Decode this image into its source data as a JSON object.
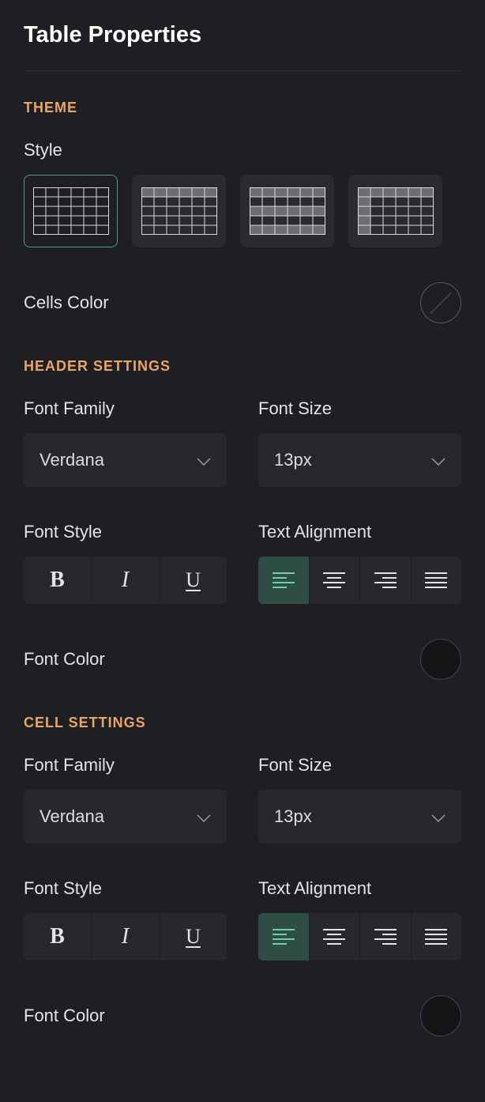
{
  "title": "Table Properties",
  "theme": {
    "heading": "THEME",
    "style_label": "Style",
    "cells_color_label": "Cells Color"
  },
  "header": {
    "heading": "HEADER SETTINGS",
    "font_family_label": "Font Family",
    "font_family_value": "Verdana",
    "font_size_label": "Font Size",
    "font_size_value": "13px",
    "font_style_label": "Font Style",
    "text_alignment_label": "Text Alignment",
    "font_color_label": "Font Color"
  },
  "cell": {
    "heading": "CELL SETTINGS",
    "font_family_label": "Font Family",
    "font_family_value": "Verdana",
    "font_size_label": "Font Size",
    "font_size_value": "13px",
    "font_style_label": "Font Style",
    "text_alignment_label": "Text Alignment",
    "font_color_label": "Font Color"
  },
  "glyphs": {
    "bold": "B",
    "italic": "I",
    "underline": "U"
  }
}
